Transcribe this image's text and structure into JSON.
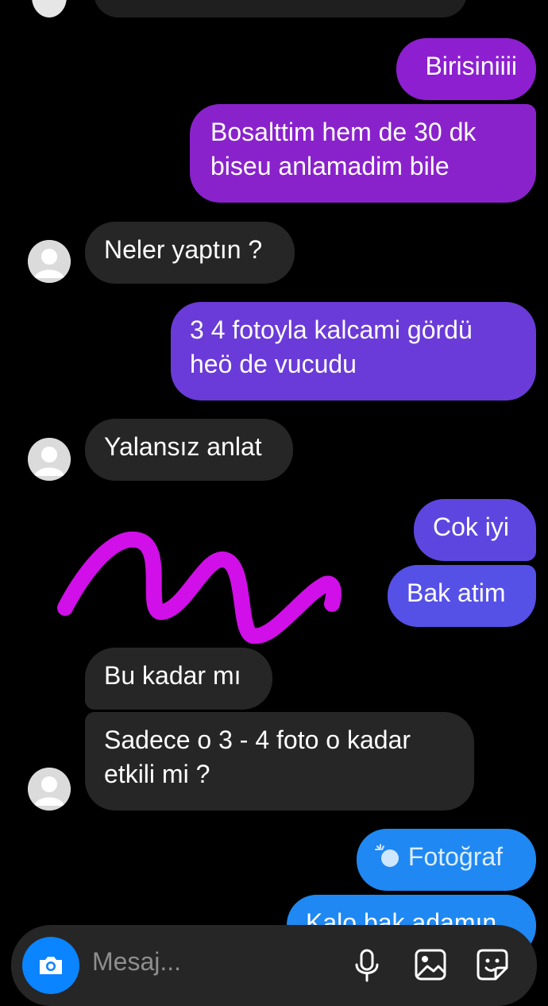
{
  "messages": {
    "m1": "Birisiniiii",
    "m2_line1": "Bosalttim hem de 30 dk",
    "m2_line2": "biseu anlamadim bile",
    "m3": "Neler yaptın ?",
    "m4_line1": "3 4 fotoyla kalcami gördü",
    "m4_line2": "heö de vucudu",
    "m5": "Yalansız anlat",
    "m6": "Cok iyi",
    "m7": "Bak atim",
    "m8": "Bu kadar mı",
    "m9_line1": "Sadece o 3 - 4 foto o kadar",
    "m9_line2": "etkili mi ?",
    "m10": "Fotoğraf",
    "m11_partial": "Kalo bak adamın"
  },
  "composer": {
    "placeholder": "Mesaj..."
  },
  "icons": {
    "camera": "camera-icon",
    "microphone": "microphone-icon",
    "gallery": "gallery-icon",
    "sticker": "sticker-icon",
    "photo_sparkle": "photo-sparkle-icon",
    "avatar": "default-avatar-icon"
  },
  "colors": {
    "background": "#000000",
    "incoming_bubble": "#262626",
    "outgoing_purple": "#9020c8",
    "outgoing_violet": "#6a3fd6",
    "outgoing_blue": "#1f88f2",
    "scribble": "#d10fe8",
    "camera_button": "#0a84ff"
  }
}
